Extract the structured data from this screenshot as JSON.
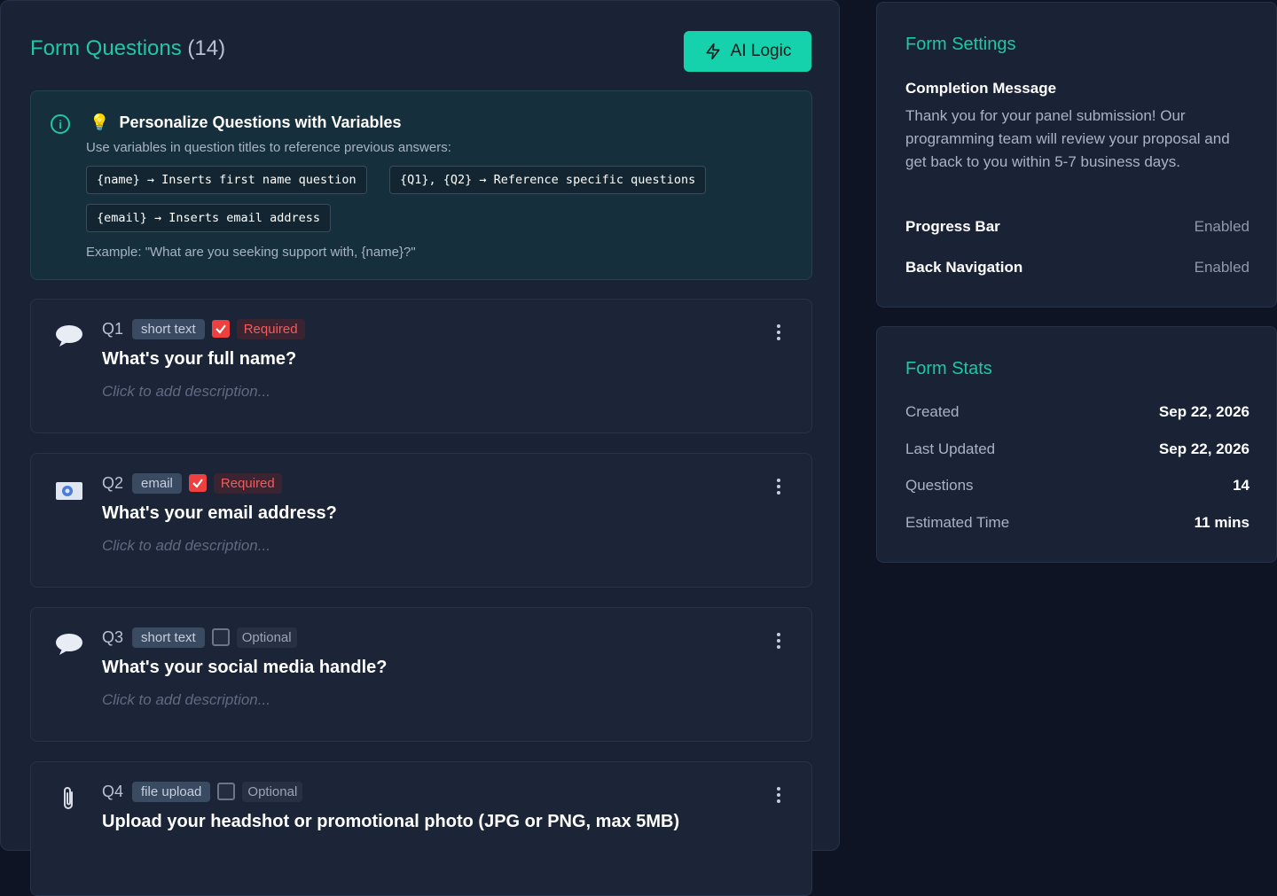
{
  "header": {
    "title": "Form Questions",
    "count": "(14)",
    "ai_button": "AI Logic"
  },
  "info": {
    "title": "Personalize Questions with Variables",
    "bulb": "💡",
    "info_glyph": "i",
    "subtitle": "Use variables in question titles to reference previous answers:",
    "chips": [
      "{name} → Inserts first name question",
      "{Q1}, {Q2} → Reference specific questions",
      "{email} → Inserts email address"
    ],
    "example": "Example: \"What are you seeking support with, {name}?\""
  },
  "questions": [
    {
      "num": "Q1",
      "type": "short text",
      "status": "Required",
      "required": true,
      "icon": "speech-bubble-icon",
      "title": "What's your full name?",
      "description_placeholder": "Click to add description..."
    },
    {
      "num": "Q2",
      "type": "email",
      "status": "Required",
      "required": true,
      "icon": "email-icon",
      "title": "What's your email address?",
      "description_placeholder": "Click to add description..."
    },
    {
      "num": "Q3",
      "type": "short text",
      "status": "Optional",
      "required": false,
      "icon": "speech-bubble-icon",
      "title": "What's your social media handle?",
      "description_placeholder": "Click to add description..."
    },
    {
      "num": "Q4",
      "type": "file upload",
      "status": "Optional",
      "required": false,
      "icon": "paperclip-icon",
      "title": "Upload your headshot or promotional photo (JPG or PNG, max 5MB)",
      "description_placeholder": ""
    }
  ],
  "settings": {
    "title": "Form Settings",
    "completion_label": "Completion Message",
    "completion_text": "Thank you for your panel submission! Our programming team will review your proposal and get back to you within 5-7 business days.",
    "progress_bar_label": "Progress Bar",
    "progress_bar_value": "Enabled",
    "back_nav_label": "Back Navigation",
    "back_nav_value": "Enabled"
  },
  "stats": {
    "title": "Form Stats",
    "created_label": "Created",
    "created_value": "Sep 22, 2026",
    "updated_label": "Last Updated",
    "updated_value": "Sep 22, 2026",
    "questions_label": "Questions",
    "questions_value": "14",
    "time_label": "Estimated Time",
    "time_value": "11 mins"
  },
  "colors": {
    "accent": "#1ec8a4",
    "required": "#ef4040",
    "background": "#0f1424",
    "panel": "#1a2236"
  }
}
